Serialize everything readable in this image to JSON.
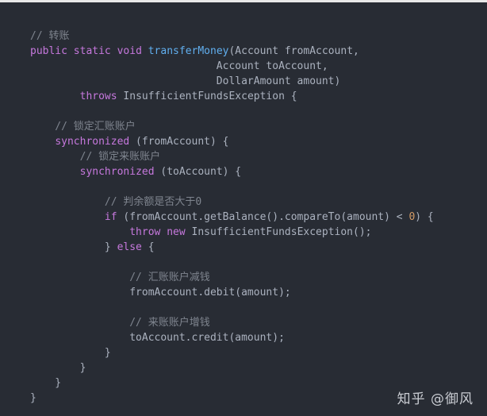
{
  "theme": {
    "background": "#282c34",
    "default_text": "#abb2bf",
    "comment": "#7f858f",
    "keyword": "#c678dd",
    "function": "#61afef",
    "number": "#d19a66",
    "page_background": "#ffffff",
    "watermark_color": "#c9ccd2"
  },
  "watermark": {
    "text": "知乎 @御风"
  },
  "code": {
    "language": "java",
    "lines": [
      {
        "indent": 0,
        "tokens": [
          {
            "t": "// 转账",
            "c": "com"
          }
        ]
      },
      {
        "indent": 0,
        "tokens": [
          {
            "t": "public",
            "c": "kw"
          },
          {
            "t": " ",
            "c": "def"
          },
          {
            "t": "static",
            "c": "kw"
          },
          {
            "t": " ",
            "c": "def"
          },
          {
            "t": "void",
            "c": "kw"
          },
          {
            "t": " ",
            "c": "def"
          },
          {
            "t": "transferMoney",
            "c": "fn"
          },
          {
            "t": "(Account fromAccount,",
            "c": "def"
          }
        ]
      },
      {
        "indent": 0,
        "tokens": [
          {
            "t": "                              Account toAccount,",
            "c": "def"
          }
        ]
      },
      {
        "indent": 0,
        "tokens": [
          {
            "t": "                              DollarAmount amount)",
            "c": "def"
          }
        ]
      },
      {
        "indent": 0,
        "tokens": [
          {
            "t": "        ",
            "c": "def"
          },
          {
            "t": "throws",
            "c": "kw"
          },
          {
            "t": " InsufficientFundsException {",
            "c": "def"
          }
        ]
      },
      {
        "indent": 0,
        "blank": true,
        "tokens": []
      },
      {
        "indent": 0,
        "tokens": [
          {
            "t": "    // 锁定汇账账户",
            "c": "com"
          }
        ]
      },
      {
        "indent": 0,
        "tokens": [
          {
            "t": "    ",
            "c": "def"
          },
          {
            "t": "synchronized",
            "c": "kw"
          },
          {
            "t": " (fromAccount) {",
            "c": "def"
          }
        ]
      },
      {
        "indent": 0,
        "tokens": [
          {
            "t": "        // 锁定来账账户",
            "c": "com"
          }
        ]
      },
      {
        "indent": 0,
        "tokens": [
          {
            "t": "        ",
            "c": "def"
          },
          {
            "t": "synchronized",
            "c": "kw"
          },
          {
            "t": " (toAccount) {",
            "c": "def"
          }
        ]
      },
      {
        "indent": 0,
        "blank": true,
        "tokens": []
      },
      {
        "indent": 0,
        "tokens": [
          {
            "t": "            // 判余额是否大于0",
            "c": "com"
          }
        ]
      },
      {
        "indent": 0,
        "tokens": [
          {
            "t": "            ",
            "c": "def"
          },
          {
            "t": "if",
            "c": "kw"
          },
          {
            "t": " (fromAccount.getBalance().compareTo(amount) < ",
            "c": "def"
          },
          {
            "t": "0",
            "c": "num"
          },
          {
            "t": ") {",
            "c": "def"
          }
        ]
      },
      {
        "indent": 0,
        "tokens": [
          {
            "t": "                ",
            "c": "def"
          },
          {
            "t": "throw",
            "c": "kw"
          },
          {
            "t": " ",
            "c": "def"
          },
          {
            "t": "new",
            "c": "kw"
          },
          {
            "t": " InsufficientFundsException();",
            "c": "def"
          }
        ]
      },
      {
        "indent": 0,
        "tokens": [
          {
            "t": "            } ",
            "c": "def"
          },
          {
            "t": "else",
            "c": "kw"
          },
          {
            "t": " {",
            "c": "def"
          }
        ]
      },
      {
        "indent": 0,
        "blank": true,
        "tokens": []
      },
      {
        "indent": 0,
        "tokens": [
          {
            "t": "                // 汇账账户减钱",
            "c": "com"
          }
        ]
      },
      {
        "indent": 0,
        "tokens": [
          {
            "t": "                fromAccount.debit(amount);",
            "c": "def"
          }
        ]
      },
      {
        "indent": 0,
        "blank": true,
        "tokens": []
      },
      {
        "indent": 0,
        "tokens": [
          {
            "t": "                // 来账账户增钱",
            "c": "com"
          }
        ]
      },
      {
        "indent": 0,
        "tokens": [
          {
            "t": "                toAccount.credit(amount);",
            "c": "def"
          }
        ]
      },
      {
        "indent": 0,
        "tokens": [
          {
            "t": "            }",
            "c": "def"
          }
        ]
      },
      {
        "indent": 0,
        "tokens": [
          {
            "t": "        }",
            "c": "def"
          }
        ]
      },
      {
        "indent": 0,
        "tokens": [
          {
            "t": "    }",
            "c": "def"
          }
        ]
      },
      {
        "indent": 0,
        "tokens": [
          {
            "t": "}",
            "c": "def"
          }
        ]
      }
    ]
  }
}
